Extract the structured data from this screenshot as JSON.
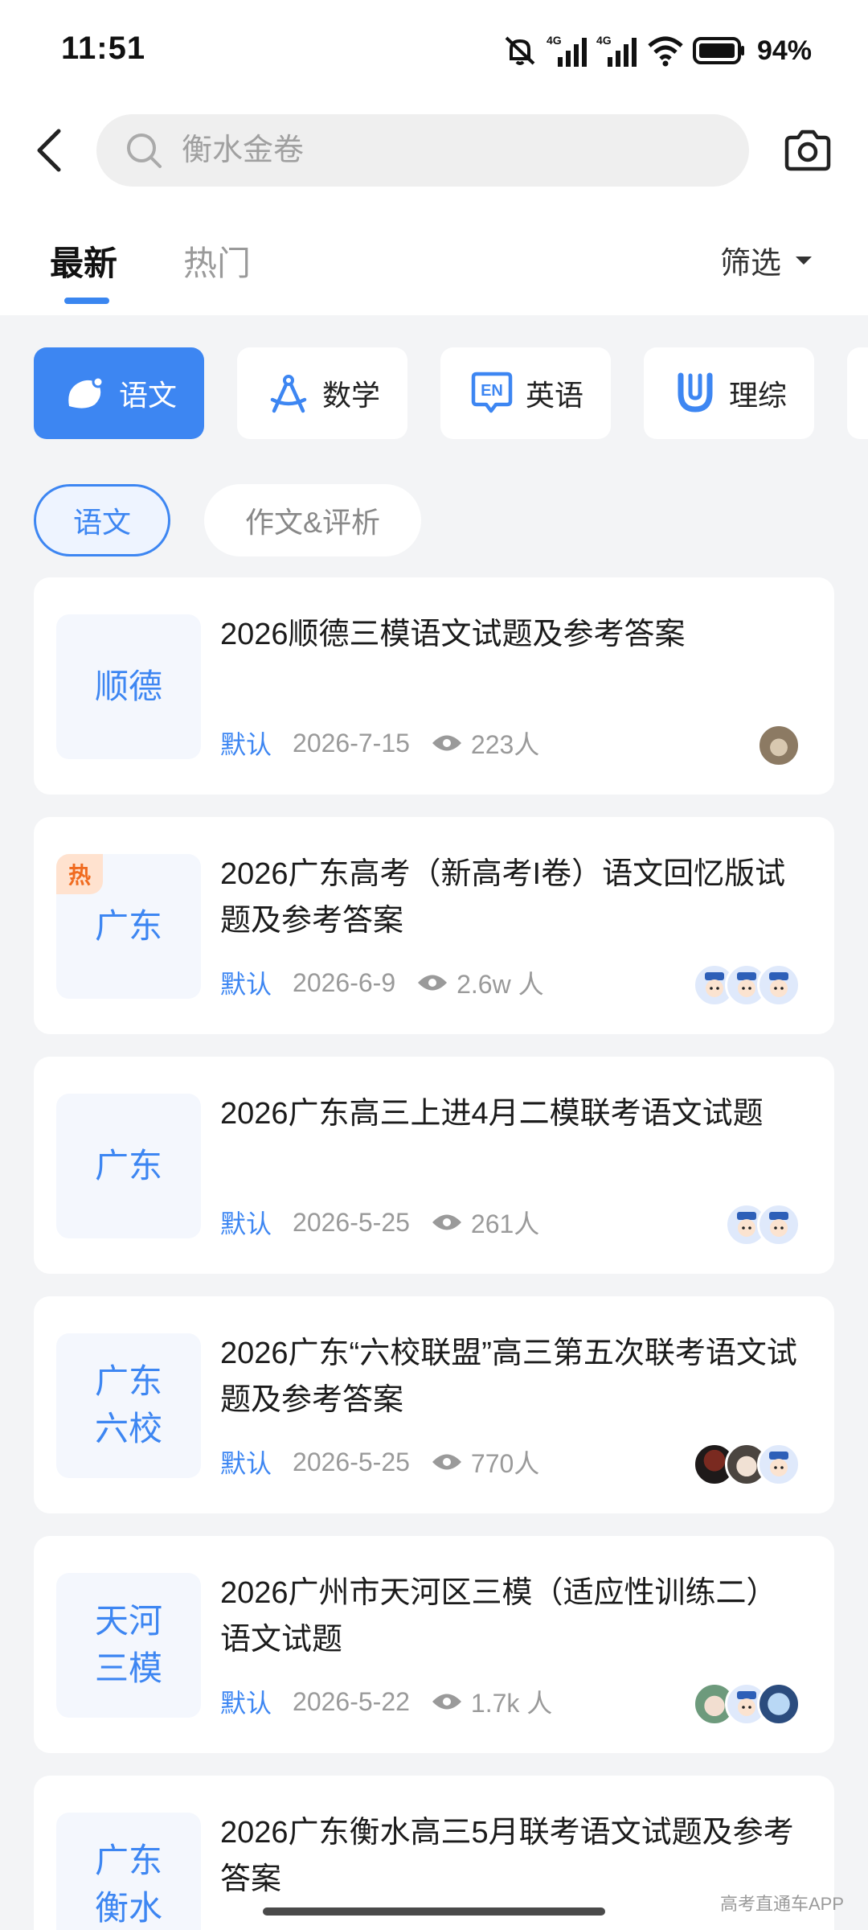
{
  "status_bar": {
    "time": "11:51",
    "signal_1": "4G",
    "signal_2": "4G",
    "battery": "94%"
  },
  "search": {
    "placeholder": "衡水金卷"
  },
  "tabs": {
    "latest": "最新",
    "hot": "热门",
    "filter": "筛选"
  },
  "subjects": [
    {
      "label": "语文",
      "icon": "chinese-icon"
    },
    {
      "label": "数学",
      "icon": "compass-icon"
    },
    {
      "label": "英语",
      "icon": "en-icon"
    },
    {
      "label": "理综",
      "icon": "magnet-icon"
    }
  ],
  "subtabs": [
    "语文",
    "作文&评析"
  ],
  "cards": [
    {
      "thumb": "顺德",
      "hot": "",
      "title": "2026顺德三模语文试题及参考答案",
      "tag": "默认",
      "date": "2026-7-15",
      "views": "223人",
      "avatars": [
        "cat"
      ]
    },
    {
      "thumb": "广东",
      "hot": "热",
      "title": "2026广东高考（新高考I卷）语文回忆版试题及参考答案",
      "tag": "默认",
      "date": "2026-6-9",
      "views": "2.6w 人",
      "avatars": [
        "cop",
        "cop",
        "cop"
      ]
    },
    {
      "thumb": "广东",
      "hot": "",
      "title": "2026广东高三上进4月二模联考语文试题",
      "tag": "默认",
      "date": "2026-5-25",
      "views": "261人",
      "avatars": [
        "cop",
        "cop"
      ]
    },
    {
      "thumb": "广东\n六校",
      "hot": "",
      "title": "2026广东“六校联盟”高三第五次联考语文试题及参考答案",
      "tag": "默认",
      "date": "2026-5-25",
      "views": "770人",
      "avatars": [
        "cop",
        "girl",
        "dark"
      ]
    },
    {
      "thumb": "天河\n三模",
      "hot": "",
      "title": "2026广州市天河区三模（适应性训练二）语文试题",
      "tag": "默认",
      "date": "2026-5-22",
      "views": "1.7k 人",
      "avatars": [
        "anime",
        "cop",
        "green"
      ]
    },
    {
      "thumb": "广东\n衡水",
      "hot": "",
      "title": "2026广东衡水高三5月联考语文试题及参考答案",
      "tag": "",
      "date": "",
      "views": "",
      "avatars": []
    }
  ],
  "watermark": "高考直通车APP",
  "colors": {
    "accent": "#3d86f2",
    "hot_bg": "#ffe2cf",
    "hot_text": "#f06b20",
    "page_bg": "#f3f4f6"
  }
}
